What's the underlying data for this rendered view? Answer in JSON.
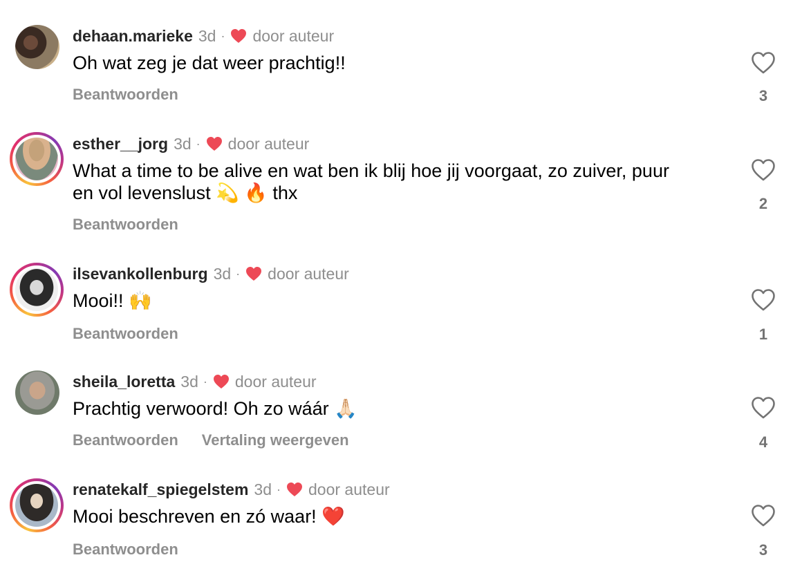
{
  "labels": {
    "reply": "Beantwoorden",
    "by_author": "door auteur",
    "translate": "Vertaling weergeven"
  },
  "colors": {
    "author_heart": "#ed4956",
    "muted": "#8e8e8e",
    "username": "#262626"
  },
  "comments": [
    {
      "username": "dehaan.marieke",
      "time": "3d",
      "text": "Oh wat zeg je dat weer prachtig!!",
      "likes": "3",
      "avatar_story_ring": false,
      "icons": [
        "heart-icon"
      ]
    },
    {
      "username": "esther__jorg",
      "time": "3d",
      "text_line1": "What a time to be alive en wat ben ik blij hoe jij voorgaat, zo zuiver, puur",
      "text_line2": "en vol levenslust 💫 🔥 thx",
      "likes": "2",
      "avatar_story_ring": true,
      "icons": [
        "heart-icon"
      ]
    },
    {
      "username": "ilsevankollenburg",
      "time": "3d",
      "text": "Mooi!! 🙌",
      "likes": "1",
      "avatar_story_ring": true,
      "icons": [
        "heart-icon"
      ]
    },
    {
      "username": "sheila_loretta",
      "time": "3d",
      "text": "Prachtig verwoord! Oh zo wáár 🙏🏻",
      "likes": "4",
      "avatar_story_ring": false,
      "icons": [
        "heart-icon"
      ]
    },
    {
      "username": "renatekalf_spiegelstem",
      "time": "3d",
      "text": "Mooi beschreven en zó waar! ❤️",
      "likes": "3",
      "avatar_story_ring": true,
      "icons": [
        "heart-icon"
      ]
    }
  ]
}
